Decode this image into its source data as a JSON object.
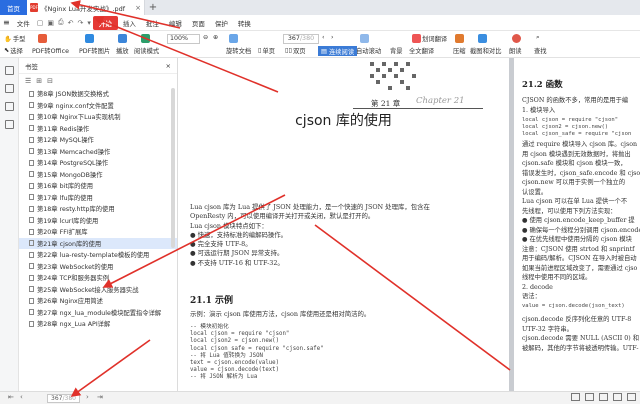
{
  "tabs": {
    "home": "首页",
    "doc_title": "《Nginx Lua开发实战》.pdf",
    "close": "×",
    "add": "+"
  },
  "menu": {
    "file": "文件",
    "start": "开始",
    "insert": "插入",
    "annotate": "批注",
    "edit": "编辑",
    "page": "页面",
    "protect": "保护",
    "convert": "转换"
  },
  "toolbar": {
    "hand": "手型",
    "select": "选择",
    "pdf_to_office": "PDF转Office",
    "pdf_to_image": "PDF转图片",
    "play": "播放",
    "read_mode": "阅读模式",
    "zoom": "100%",
    "rotate": "旋转文档",
    "single": "单页",
    "double": "双页",
    "page_current": "367",
    "page_total": "/380",
    "continuous": "连续阅读",
    "auto_scroll": "自动滚动",
    "background": "背景",
    "translate": "全文翻译",
    "compress": "压缩",
    "screenshot": "截图和对比",
    "read_aloud": "朗读",
    "search": "查找",
    "highlight": "划词翻译"
  },
  "sidebar": {
    "title": "书签",
    "items": [
      {
        "label": "第8章   JSON数据交换格式"
      },
      {
        "label": "第9章   nginx.conf文件配置"
      },
      {
        "label": "第10章   Nginx下Lua实现机制"
      },
      {
        "label": "第11章   Redis操作"
      },
      {
        "label": "第12章   MySQL操作"
      },
      {
        "label": "第13章   Memcached操作"
      },
      {
        "label": "第14章   PostgreSQL操作"
      },
      {
        "label": "第15章   MongoDB操作"
      },
      {
        "label": "第16章   bit库的使用"
      },
      {
        "label": "第17章   lfu库的使用"
      },
      {
        "label": "第18章   resty.http库的使用"
      },
      {
        "label": "第19章   lcurl库的使用"
      },
      {
        "label": "第20章   FFI扩展库"
      },
      {
        "label": "第21章   cjson库的使用"
      },
      {
        "label": "第22章   lua-resty-template模板的使用"
      },
      {
        "label": "第23章   WebSocket的使用"
      },
      {
        "label": "第24章   TCP和服务器实例"
      },
      {
        "label": "第25章   WebSocket接入服务器实战"
      },
      {
        "label": "第26章   Nginx应用简述"
      },
      {
        "label": "第27章   ngx_lua_module模块配置指令详解"
      },
      {
        "label": "第28章   ngx_Lua API详解"
      }
    ],
    "selected_index": 13
  },
  "page_left": {
    "chapter_num": "第 21 章",
    "chapter_latin": "Chapter 21",
    "chapter_title": "cjson 库的使用",
    "intro": [
      "Lua cjson 库为 Lua 提供了 JSON 处理能力，是一个快速的 JSON 处理库，包含在",
      "OpenResty 内，可以使用编译开关打开或关闭，默认是打开的。",
      "Lua cjson 模块特点如下：",
      "● 快速，支持标准的编解码操作。",
      "● 完全支持 UTF-8。",
      "● 可选运行期 JSON 异常支持。",
      "● 不支持 UTF-16 和 UTF-32。"
    ],
    "section_title": "21.1   示例",
    "section_text": "示例：演示 cjson 库使用方法，cjson 库使用还是相对简洁的。",
    "code": [
      "-- 模块初始化",
      "local cjson = require \"cjson\"",
      "local cjson2 = cjson.new()",
      "local cjson_safe = require \"cjson.safe\"",
      "",
      "-- 将 Lua 值转换为 JSON",
      "text = cjson.encode(value)",
      "value = cjson.decode(text)",
      "",
      "-- 将 JSON 解析为 Lua"
    ]
  },
  "page_right": {
    "section_title": "21.2   函数",
    "lines_top": [
      "CJSON 的函数不多，常用的是用于编",
      "1. 模块导入"
    ],
    "code1": [
      "local cjson = require \"cjson\"",
      "local cjson2 = cjson.new()",
      "local cjson_safe = require \"cjson"
    ],
    "lines_mid": [
      "通过 require 模块导入 cjson 库。cjson",
      "用 cjson 模块遇到无效数据时，将抛出",
      "cjson.safe 模块和 cjson 模块一致，",
      "错误发生时，cjson_safe.encode 和 cjson_s",
      "cjson.new 可以用于实例一个独立的",
      "认设置。",
      "Lua cjson 可以在单 Lua 提供一个不",
      "先线程，可以使用下列方法实现：",
      "● 使用 cjson.encode_keep_buffer 提",
      "● 确保每一个线程分别调用 cjson.encode",
      "● 在优先线程中使用分隔的 cjson 模块",
      "注意：CJSON 使用 strtod 和 snprintf",
      "用于编码/解析。CJSON 在导入时被自动",
      "如果当前进程区域改变了，需要通过 cjso",
      "线程中使用不同的区域。",
      "2. decode",
      "语法："
    ],
    "code2": "value = cjson.decode(json_text)",
    "lines_bottom": [
      "cjson.decode 反序列化任意的 UTF-8",
      "UTF-32 字符串。",
      "cjson.decode 需要 NULL (ASCII 0) 和",
      "被解码，其他的字节将被透明传输。UTF-"
    ]
  },
  "statusbar": {
    "page_current": "367",
    "page_total": "/380"
  }
}
